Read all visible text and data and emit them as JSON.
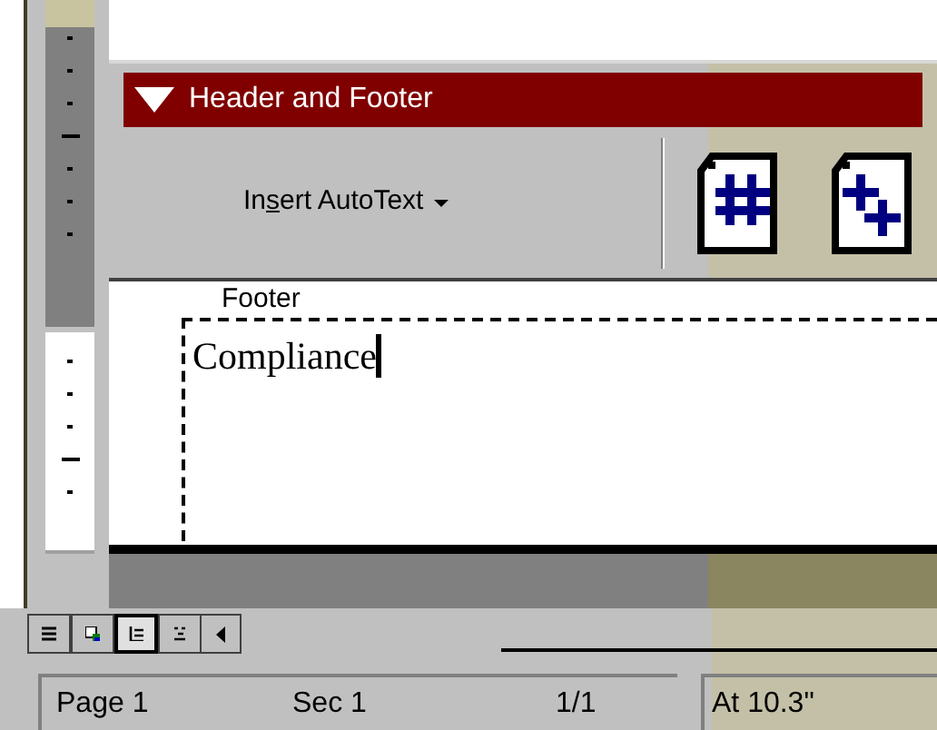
{
  "toolbar": {
    "title": "Header and Footer",
    "insert_autotext": {
      "label_before": "In",
      "access_key": "s",
      "label_after": "ert AutoText"
    }
  },
  "document": {
    "footer_label": "Footer",
    "footer_text": "Compliance"
  },
  "view_buttons": [
    {
      "kind": "normal",
      "selected": false
    },
    {
      "kind": "web",
      "selected": false
    },
    {
      "kind": "print",
      "selected": true
    },
    {
      "kind": "outline",
      "selected": false
    }
  ],
  "status_bar": {
    "page": "Page 1",
    "section": "Sec 1",
    "pages": "1/1",
    "position": "At 10.3\""
  }
}
